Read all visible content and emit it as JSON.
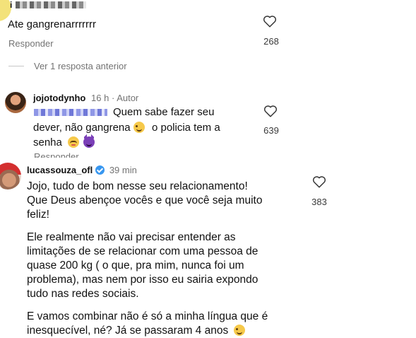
{
  "comment1": {
    "username_obscured": "i",
    "text": "Ate gangrenarrrrrrr",
    "reply_label": "Responder",
    "likes": "268"
  },
  "view_replies": {
    "label": "Ver 1 resposta anterior"
  },
  "comment2": {
    "username": "jojotodynho",
    "time": "16 h",
    "separator": "·",
    "author_tag": "Autor",
    "text_line1": "Quem sabe fazer seu",
    "text_line2a": "dever, não gangrena",
    "text_line2b": "o policia tem a",
    "text_line3": "senha",
    "reply_label": "Responder",
    "likes": "639"
  },
  "comment3": {
    "username": "lucassouza_ofl",
    "time": "39 min",
    "para1_line1": "Jojo, tudo de bom nesse seu relacionamento!",
    "para1_line2": "Que Deus abençoe vocês e que você seja muito",
    "para1_line3": "feliz!",
    "para2_line1": "Ele realmente não vai precisar entender as",
    "para2_line2": "limitações de se relacionar com uma pessoa de",
    "para2_line3": "quase 200 kg ( o que, pra mim, nunca foi um",
    "para2_line4": "problema), mas nem por isso eu sairia expondo",
    "para2_line5": "tudo nas redes sociais.",
    "para3_line1": "E vamos combinar não é só a minha língua que é",
    "para3_line2": "inesquecível, né? Já se passaram 4 anos",
    "likes": "383"
  },
  "colors": {
    "text": "#111111",
    "muted": "#737373",
    "verified": "#3897f0",
    "mention_blur": "#8f97e6"
  },
  "icons": [
    "heart-icon",
    "verified-badge-icon",
    "wink-emoji",
    "relieved-emoji",
    "devil-emoji"
  ]
}
